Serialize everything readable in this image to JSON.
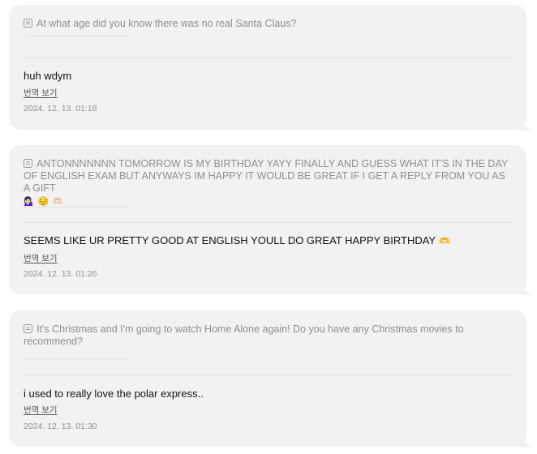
{
  "cards": [
    {
      "question": "At what age did you know there was no real Santa Claus?",
      "answer": "huh wdym",
      "translate_label": "번역 보기",
      "timestamp": "2024. 12. 13. 01:18"
    },
    {
      "question": "ANTONNNNNNN TOMORROW IS MY BIRTHDAY YAYY FINALLY AND GUESS WHAT IT'S IN THE DAY OF ENGLISH EXAM BUT ANYWAYS IM HAPPY IT WOULD BE GREAT IF I GET A REPLY FROM YOU AS A GIFT",
      "question_emojis": [
        "💁🏻‍♀️",
        "😔",
        "🫶🏻"
      ],
      "answer": "SEEMS LIKE UR PRETTY GOOD AT ENGLISH YOULL DO GREAT HAPPY BIRTHDAY",
      "answer_emoji": "🫶",
      "translate_label": "번역 보기",
      "timestamp": "2024. 12. 13. 01:26"
    },
    {
      "question": "It's Christmas and I'm going to watch Home Alone again! Do you have any Christmas movies to recommend?",
      "answer": "i used to really love the polar express..",
      "translate_label": "번역 보기",
      "timestamp": "2024. 12. 13. 01:30"
    }
  ],
  "icons": {
    "question_icon": "document-icon"
  },
  "colors": {
    "card_bg": "#f2f2f4",
    "question_text": "#8f8f93",
    "answer_text": "#111111",
    "meta_text": "#8f8f93"
  }
}
